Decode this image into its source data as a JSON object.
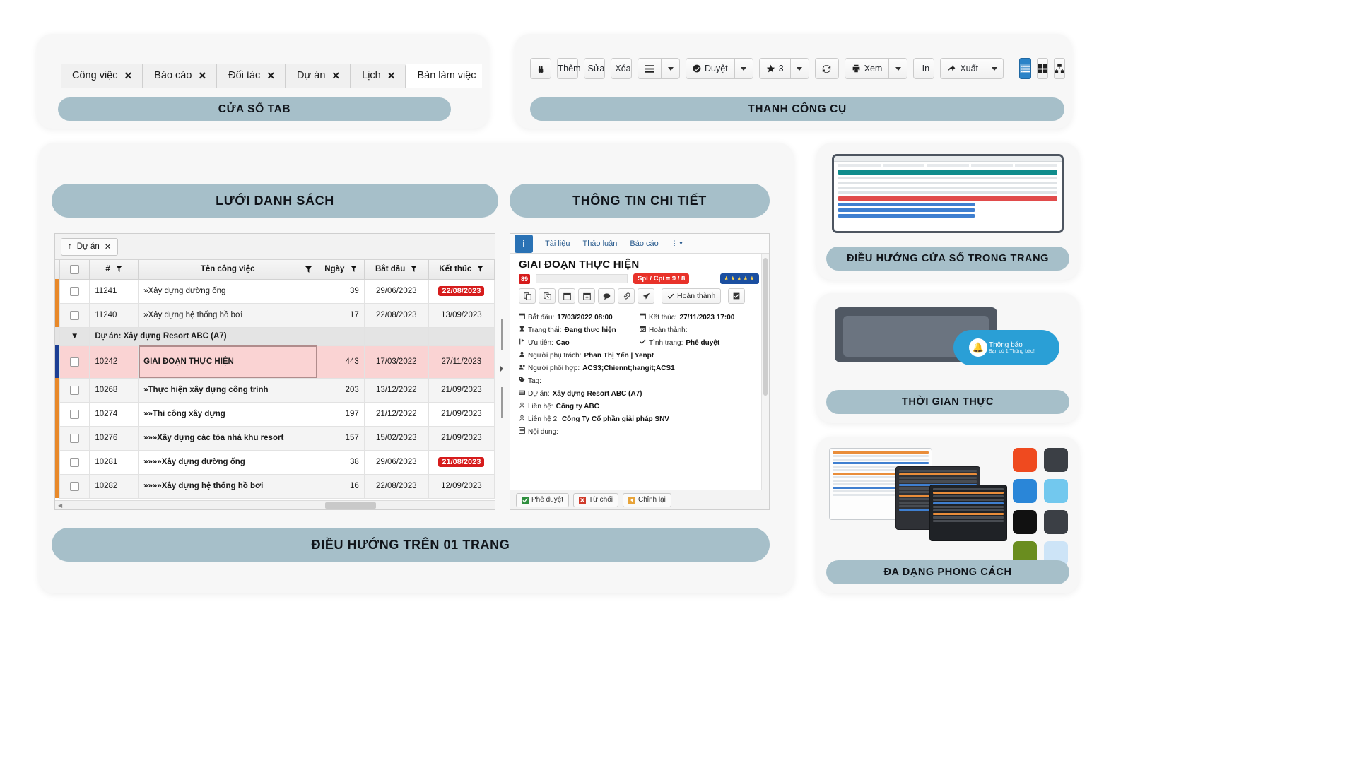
{
  "tab_window": {
    "caption": "CỬA SỔ TAB",
    "tabs": [
      {
        "label": "Công việc",
        "close": "✕",
        "active": false
      },
      {
        "label": "Báo cáo",
        "close": "✕",
        "active": false
      },
      {
        "label": "Đối tác",
        "close": "✕",
        "active": false
      },
      {
        "label": "Dự án",
        "close": "✕",
        "active": false
      },
      {
        "label": "Lịch",
        "close": "✕",
        "active": false
      },
      {
        "label": "Bàn làm việc",
        "close": "✕",
        "active": true
      }
    ]
  },
  "toolbar_window": {
    "caption": "THANH CÔNG CỤ",
    "buttons": [
      {
        "name": "binoculars-icon",
        "icon": "🔍",
        "label": ""
      },
      {
        "name": "add-button",
        "icon": "⊕",
        "label": "Thêm"
      },
      {
        "name": "edit-button",
        "icon": "✎",
        "label": "Sửa"
      },
      {
        "name": "delete-button",
        "icon": "🗑",
        "label": "Xóa"
      },
      {
        "name": "menu-button",
        "icon": "☰",
        "label": ""
      },
      {
        "name": "approve-button",
        "icon": "✔",
        "label": "Duyệt"
      },
      {
        "name": "star-button",
        "icon": "☆",
        "label": "3"
      },
      {
        "name": "refresh-button",
        "icon": "↻",
        "label": ""
      },
      {
        "name": "view-button",
        "icon": "🖶",
        "label": "Xem"
      },
      {
        "name": "print-button",
        "icon": "🖶",
        "label": "In"
      },
      {
        "name": "export-button",
        "icon": "➜",
        "label": "Xuất"
      }
    ],
    "view_modes": [
      "list-view",
      "grid-view",
      "tree-view"
    ]
  },
  "main": {
    "grid_caption": "LƯỚI DANH SÁCH",
    "detail_caption": "THÔNG TIN CHI TIẾT",
    "nav_caption": "ĐIỀU HƯỚNG TRÊN 01 TRANG"
  },
  "grid": {
    "group_chip": {
      "arrow": "↑",
      "label": "Dự án",
      "close": "✕"
    },
    "columns": [
      "#",
      "Tên công việc",
      "Ngày",
      "Bắt đầu",
      "Kết thúc"
    ],
    "rows": [
      {
        "id": "11241",
        "name": "»Xây dựng đường ống",
        "days": "39",
        "start": "29/06/2023",
        "end": "22/08/2023",
        "end_badge": true,
        "alt": false,
        "selected": false
      },
      {
        "id": "11240",
        "name": "»Xây dựng hệ thống hồ bơi",
        "days": "17",
        "start": "22/08/2023",
        "end": "13/09/2023",
        "end_badge": false,
        "alt": true,
        "selected": false
      }
    ],
    "group_row": {
      "arrow": "▼",
      "label": "Dự án: Xây dựng Resort ABC (A7)"
    },
    "rows2": [
      {
        "id": "10242",
        "name": "GIAI ĐOẠN THỰC HIỆN",
        "days": "443",
        "start": "17/03/2022",
        "end": "27/11/2023",
        "end_badge": false,
        "alt": false,
        "selected": true
      },
      {
        "id": "10268",
        "name": "»Thực hiện xây dựng công trình",
        "days": "203",
        "start": "13/12/2022",
        "end": "21/09/2023",
        "end_badge": false,
        "alt": true,
        "selected": false
      },
      {
        "id": "10274",
        "name": "»»Thi công xây dựng",
        "days": "197",
        "start": "21/12/2022",
        "end": "21/09/2023",
        "end_badge": false,
        "alt": false,
        "selected": false
      },
      {
        "id": "10276",
        "name": "»»»Xây dựng các tòa nhà khu resort",
        "days": "157",
        "start": "15/02/2023",
        "end": "21/09/2023",
        "end_badge": false,
        "alt": true,
        "selected": false
      },
      {
        "id": "10281",
        "name": "»»»»Xây dựng đường ống",
        "days": "38",
        "start": "29/06/2023",
        "end": "21/08/2023",
        "end_badge": true,
        "alt": false,
        "selected": false
      },
      {
        "id": "10282",
        "name": "»»»»Xây dựng hệ thống hồ bơi",
        "days": "16",
        "start": "22/08/2023",
        "end": "12/09/2023",
        "end_badge": false,
        "alt": true,
        "selected": false
      }
    ]
  },
  "detail": {
    "tabs": [
      "Tài liệu",
      "Thảo luận",
      "Báo cáo"
    ],
    "more": "⋮ ▾",
    "title": "GIAI ĐOẠN THỰC HIỆN",
    "percent": "89",
    "spi_cpi": "Spi / Cpi = 9 / 8",
    "stars": "★★★★★",
    "complete_button": "Hoàn thành",
    "icons": [
      "copy-icon",
      "duplicate-icon",
      "calendar-icon",
      "calendar-add-icon",
      "comment-icon",
      "attachment-icon",
      "send-icon"
    ],
    "fields": [
      {
        "label": "Bắt đầu:",
        "value": "17/03/2022 08:00",
        "icon": "calendar-icon"
      },
      {
        "label": "Kết thúc:",
        "value": "27/11/2023 17:00",
        "icon": "calendar-icon"
      },
      {
        "label": "Trạng thái:",
        "value": "Đang thực hiện",
        "icon": "hourglass-icon"
      },
      {
        "label": "Hoàn thành:",
        "value": "",
        "icon": "calendar-check-icon"
      },
      {
        "label": "Ưu tiên:",
        "value": "Cao",
        "icon": "priority-icon"
      },
      {
        "label": "Tình trạng:",
        "value": "Phê duyệt",
        "icon": "check-icon"
      },
      {
        "label": "Người phụ trách:",
        "value": "Phan Thị Yến | Yenpt",
        "icon": "user-icon"
      },
      {
        "label": "Người phối hợp:",
        "value": "ACS3;Chiennt;hangit;ACS1",
        "icon": "users-icon"
      },
      {
        "label": "Tag:",
        "value": "",
        "icon": "tag-icon"
      },
      {
        "label": "Dự án:",
        "value": "Xây dựng Resort ABC (A7)",
        "icon": "project-icon"
      },
      {
        "label": "Liên hệ:",
        "value": "Công ty ABC",
        "icon": "contact-icon"
      },
      {
        "label": "Liên hệ 2:",
        "value": "Công Ty Cổ phần giải pháp SNV",
        "icon": "contact-icon"
      },
      {
        "label": "Nội dung:",
        "value": "",
        "icon": "content-icon"
      }
    ],
    "footer_buttons": [
      {
        "label": "Phê duyệt",
        "icon": "approve-icon"
      },
      {
        "label": "Từ chối",
        "icon": "reject-icon"
      },
      {
        "label": "Chỉnh lại",
        "icon": "revise-icon"
      }
    ]
  },
  "right_cards": {
    "nav": {
      "caption": "ĐIỀU HƯỚNG CỬA SỔ TRONG TRANG"
    },
    "realtime": {
      "caption": "THỜI GIAN THỰC",
      "bubble_title": "Thông báo",
      "bubble_sub": "Bạn có 1 Thông báo!"
    },
    "style": {
      "caption": "ĐA DẠNG PHONG CÁCH",
      "swatches": [
        "#ef4a1f",
        "#3b3f45",
        "#2a86d8",
        "#72c8ee",
        "#111111",
        "#3b3f45",
        "#6a8d1f",
        "#cde4f7"
      ]
    }
  }
}
